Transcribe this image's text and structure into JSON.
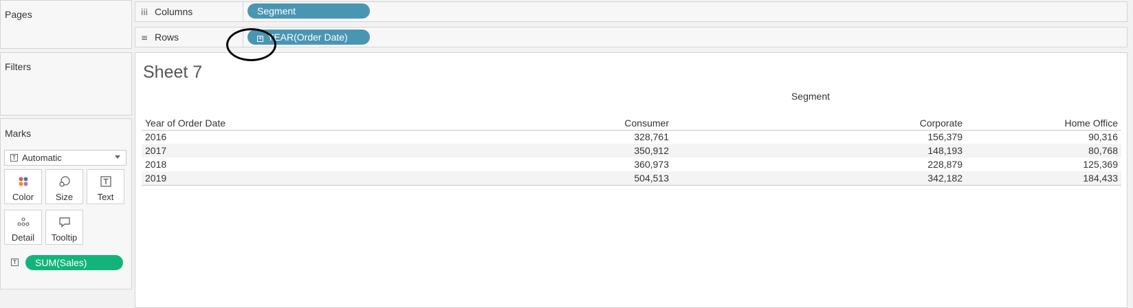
{
  "cards": {
    "pages": "Pages",
    "filters": "Filters",
    "marks": "Marks"
  },
  "marks": {
    "mark_type": "Automatic",
    "buttons": {
      "color": "Color",
      "size": "Size",
      "text": "Text",
      "detail": "Detail",
      "tooltip": "Tooltip"
    },
    "field": "SUM(Sales)"
  },
  "shelves": {
    "columns_label": "Columns",
    "columns_pill": "Segment",
    "rows_label": "Rows",
    "rows_pill": "YEAR(Order Date)"
  },
  "sheet": {
    "title": "Sheet 7",
    "column_header": "Segment",
    "table": {
      "headers": [
        "Year of Order Date",
        "Consumer",
        "Corporate",
        "Home Office"
      ],
      "rows": [
        [
          "2016",
          "328,761",
          "156,379",
          "90,316"
        ],
        [
          "2017",
          "350,912",
          "148,193",
          "80,768"
        ],
        [
          "2018",
          "360,973",
          "228,879",
          "125,369"
        ],
        [
          "2019",
          "504,513",
          "342,182",
          "184,433"
        ]
      ]
    }
  },
  "colors": {
    "dimension_pill": "#4996b2",
    "measure_pill": "#13b47b"
  }
}
